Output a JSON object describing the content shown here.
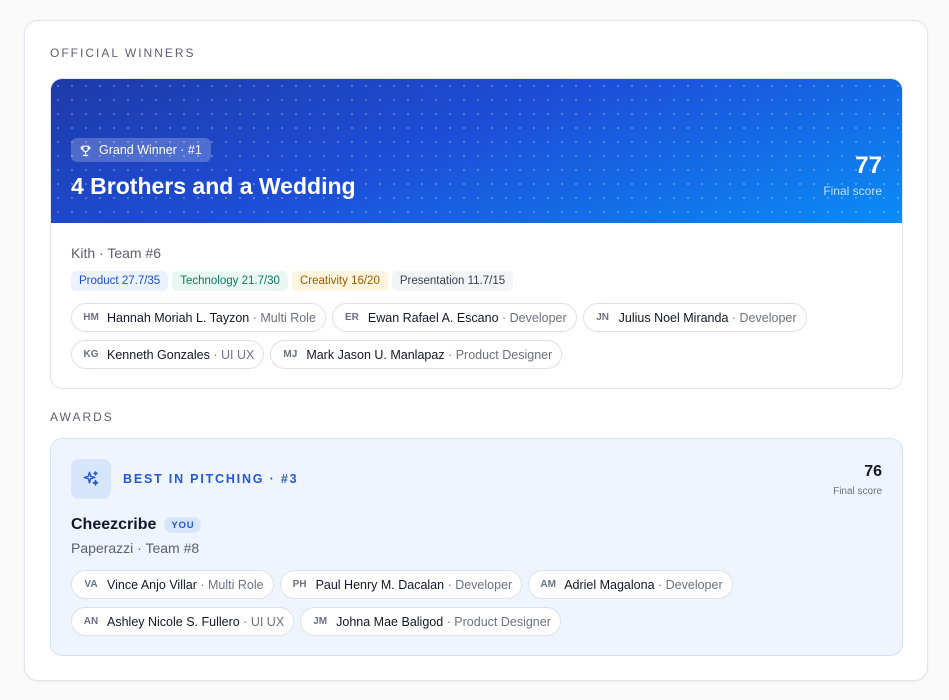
{
  "sections": {
    "winners_label": "OFFICIAL WINNERS",
    "awards_label": "AWARDS"
  },
  "winner": {
    "badge": "Grand Winner · #1",
    "badge_icon": "trophy-icon",
    "title": "4 Brothers and a Wedding",
    "score": "77",
    "score_caption": "Final score",
    "team_line": "Kith · Team #6",
    "categories": [
      {
        "label": "Product 27.7/35",
        "color": "#1d4ed8"
      },
      {
        "label": "Technology 21.7/30",
        "color": "#0f7a5c"
      },
      {
        "label": "Creativity 16/20",
        "color": "#a05a00"
      },
      {
        "label": "Presentation 11.7/15",
        "color": "#374151"
      }
    ],
    "members": [
      {
        "initials": "HM",
        "name": "Hannah Moriah L. Tayzon",
        "role": "Multi Role"
      },
      {
        "initials": "ER",
        "name": "Ewan Rafael A. Escano",
        "role": "Developer"
      },
      {
        "initials": "JN",
        "name": "Julius Noel Miranda",
        "role": "Developer"
      },
      {
        "initials": "KG",
        "name": "Kenneth Gonzales",
        "role": "UI UX"
      },
      {
        "initials": "MJ",
        "name": "Mark Jason U. Manlapaz",
        "role": "Product Designer"
      }
    ]
  },
  "award": {
    "icon": "sparkles-icon",
    "name": "BEST IN PITCHING · #3",
    "score": "76",
    "score_caption": "Final score",
    "title": "Cheezcribe",
    "you_badge": "YOU",
    "team_line": "Paperazzi · Team #8",
    "members": [
      {
        "initials": "VA",
        "name": "Vince Anjo Villar",
        "role": "Multi Role"
      },
      {
        "initials": "PH",
        "name": "Paul Henry M. Dacalan",
        "role": "Developer"
      },
      {
        "initials": "AM",
        "name": "Adriel Magalona",
        "role": "Developer"
      },
      {
        "initials": "AN",
        "name": "Ashley Nicole S. Fullero",
        "role": "UI UX"
      },
      {
        "initials": "JM",
        "name": "Johna Mae Baligod",
        "role": "Product Designer"
      }
    ]
  },
  "colors": {
    "accent": "#2458d4",
    "banner_start": "#1e3aa8",
    "banner_end": "#0a8cf5"
  }
}
